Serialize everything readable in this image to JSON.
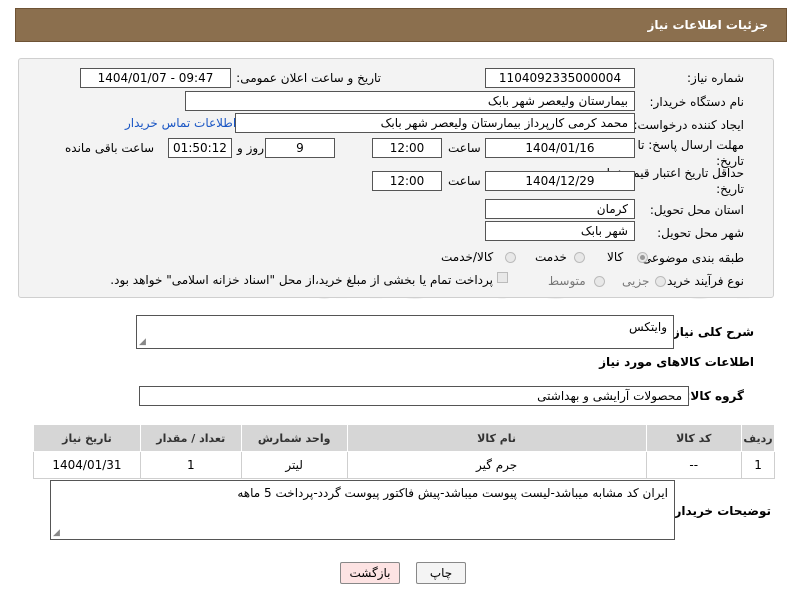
{
  "header": {
    "title": "جزئیات اطلاعات نیاز"
  },
  "form": {
    "need_number_label": "شماره نیاز:",
    "need_number": "1104092335000004",
    "announce_label": "تاریخ و ساعت اعلان عمومی:",
    "announce_value": "1404/01/07 - 09:47",
    "buyer_org_label": "نام دستگاه خریدار:",
    "buyer_org": "بیمارستان ولیعصر شهر بابک",
    "requester_label": "ایجاد کننده درخواست:",
    "requester": "محمد  کرمی  کارپرداز  بیمارستان ولیعصر شهر بابک",
    "contact_link": "اطلاعات تماس خریدار",
    "deadline_label": "مهلت ارسال پاسخ: تا تاریخ:",
    "deadline_date": "1404/01/16",
    "time_label": "ساعت",
    "deadline_time": "12:00",
    "days_value": "9",
    "days_label": "روز و",
    "remaining_time": "01:50:12",
    "remaining_label": "ساعت باقی مانده",
    "validity_label": "حداقل تاریخ اعتبار قیمت: تا تاریخ:",
    "validity_date": "1404/12/29",
    "validity_time": "12:00",
    "province_label": "استان محل تحویل:",
    "province": "کرمان",
    "city_label": "شهر محل تحویل:",
    "city": "شهر بابک",
    "category_label": "طبقه بندی موضوعی:",
    "category_options": [
      "کالا",
      "خدمت",
      "کالا/خدمت"
    ],
    "process_label": "نوع فرآیند خرید :",
    "process_options": [
      "جزیی",
      "متوسط"
    ],
    "payment_text": "پرداخت تمام یا بخشی از مبلغ خرید،از محل \"اسناد خزانه اسلامی\" خواهد بود."
  },
  "summary": {
    "label": "شرح کلی نیاز:",
    "value": "وایتکس"
  },
  "goods_info": {
    "title": "اطلاعات کالاهای مورد نیاز",
    "group_label": "گروه کالا:",
    "group_value": "محصولات آرایشی و بهداشتی"
  },
  "table": {
    "headers": [
      "ردیف",
      "کد کالا",
      "نام کالا",
      "واحد شمارش",
      "تعداد / مقدار",
      "تاریخ نیاز"
    ],
    "rows": [
      [
        "1",
        "--",
        "جرم گیر",
        "لیتر",
        "1",
        "1404/01/31"
      ]
    ]
  },
  "buyer_notes": {
    "label": "توضیحات خریدار:",
    "value": "ایران کد مشابه میباشد-لیست پیوست میباشد-پیش فاکتور پیوست گردد-پرداخت 5 ماهه"
  },
  "buttons": {
    "print": "چاپ",
    "back": "بازگشت"
  },
  "watermark": "AriaTender.neT",
  "colors": {
    "header_bg": "#8b6f4e",
    "link": "#1a56c4",
    "back_btn_bg": "#fde3e3"
  }
}
